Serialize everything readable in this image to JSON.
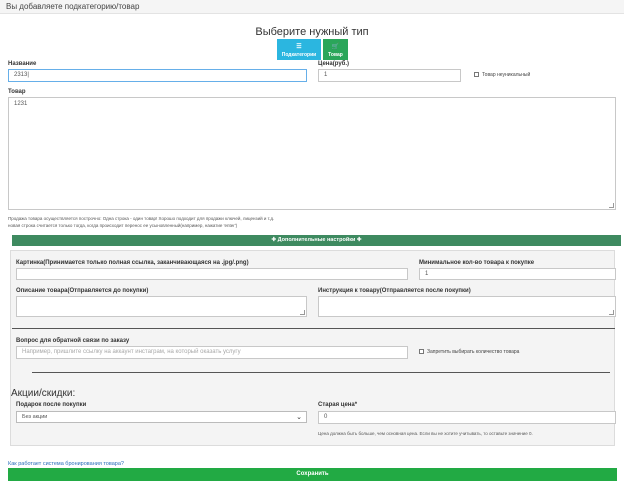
{
  "header": {
    "title": "Вы добавляете подкатегорию/товар"
  },
  "type_select": {
    "title": "Выберите нужный тип",
    "subcategory_label": "Подкатегории",
    "product_label": "Товар"
  },
  "form": {
    "name_label": "Название",
    "name_value": "2313|",
    "price_label": "Цена(руб.)",
    "price_value": "1",
    "infinite_label": "Товар неуникальный",
    "product_label": "Товар",
    "product_value": "1231",
    "help_line1": "Продажа товара осуществляется построчно: Одна строка - один товар! Хорошо подходит для продажи ключей, лицензий и т.д.",
    "help_line2": "новая строка считается только тогда, когда происходит перенос ее усыновленный(например, нажатие 'enter')"
  },
  "advanced": {
    "toggle_label": "✚ Дополнительные настройки ✚",
    "image_label": "Картинка(Принимается только полная ссылка, заканчивающаяся на .jpg/.png)",
    "min_qty_label": "Минимальное кол-во товара к покупке",
    "min_qty_value": "1",
    "description_label": "Описание товара(Отправляется до покупки)",
    "instruction_label": "Инструкция к товару(Отправляется после покупки)",
    "feedback_label": "Вопрос для обратной связи по заказу",
    "feedback_placeholder": "Например, пришлите ссылку на аккаунт инстаграм, на который оказать услугу",
    "forbid_qty_label": "Запретить выбирать количество товара"
  },
  "promo": {
    "title": "Акции/скидки:",
    "gift_label": "Подарок после покупки",
    "gift_value": "Без акции",
    "old_price_label": "Старая цена*",
    "old_price_required": "*",
    "old_price_value": "0",
    "old_price_hint": "Цена должна быть больше, чем основная цена. Если вы не хотите учитывать, то оставьте значение 0."
  },
  "footer": {
    "link_text": "Как работает система бронирования товара?",
    "save_label": "Сохранить"
  },
  "colors": {
    "subcategory_button": "#2bb6e0",
    "product_button": "#2aa65a",
    "advanced_bar": "#3e8a60",
    "save_button": "#22aa44",
    "link": "#2a6ebb"
  }
}
